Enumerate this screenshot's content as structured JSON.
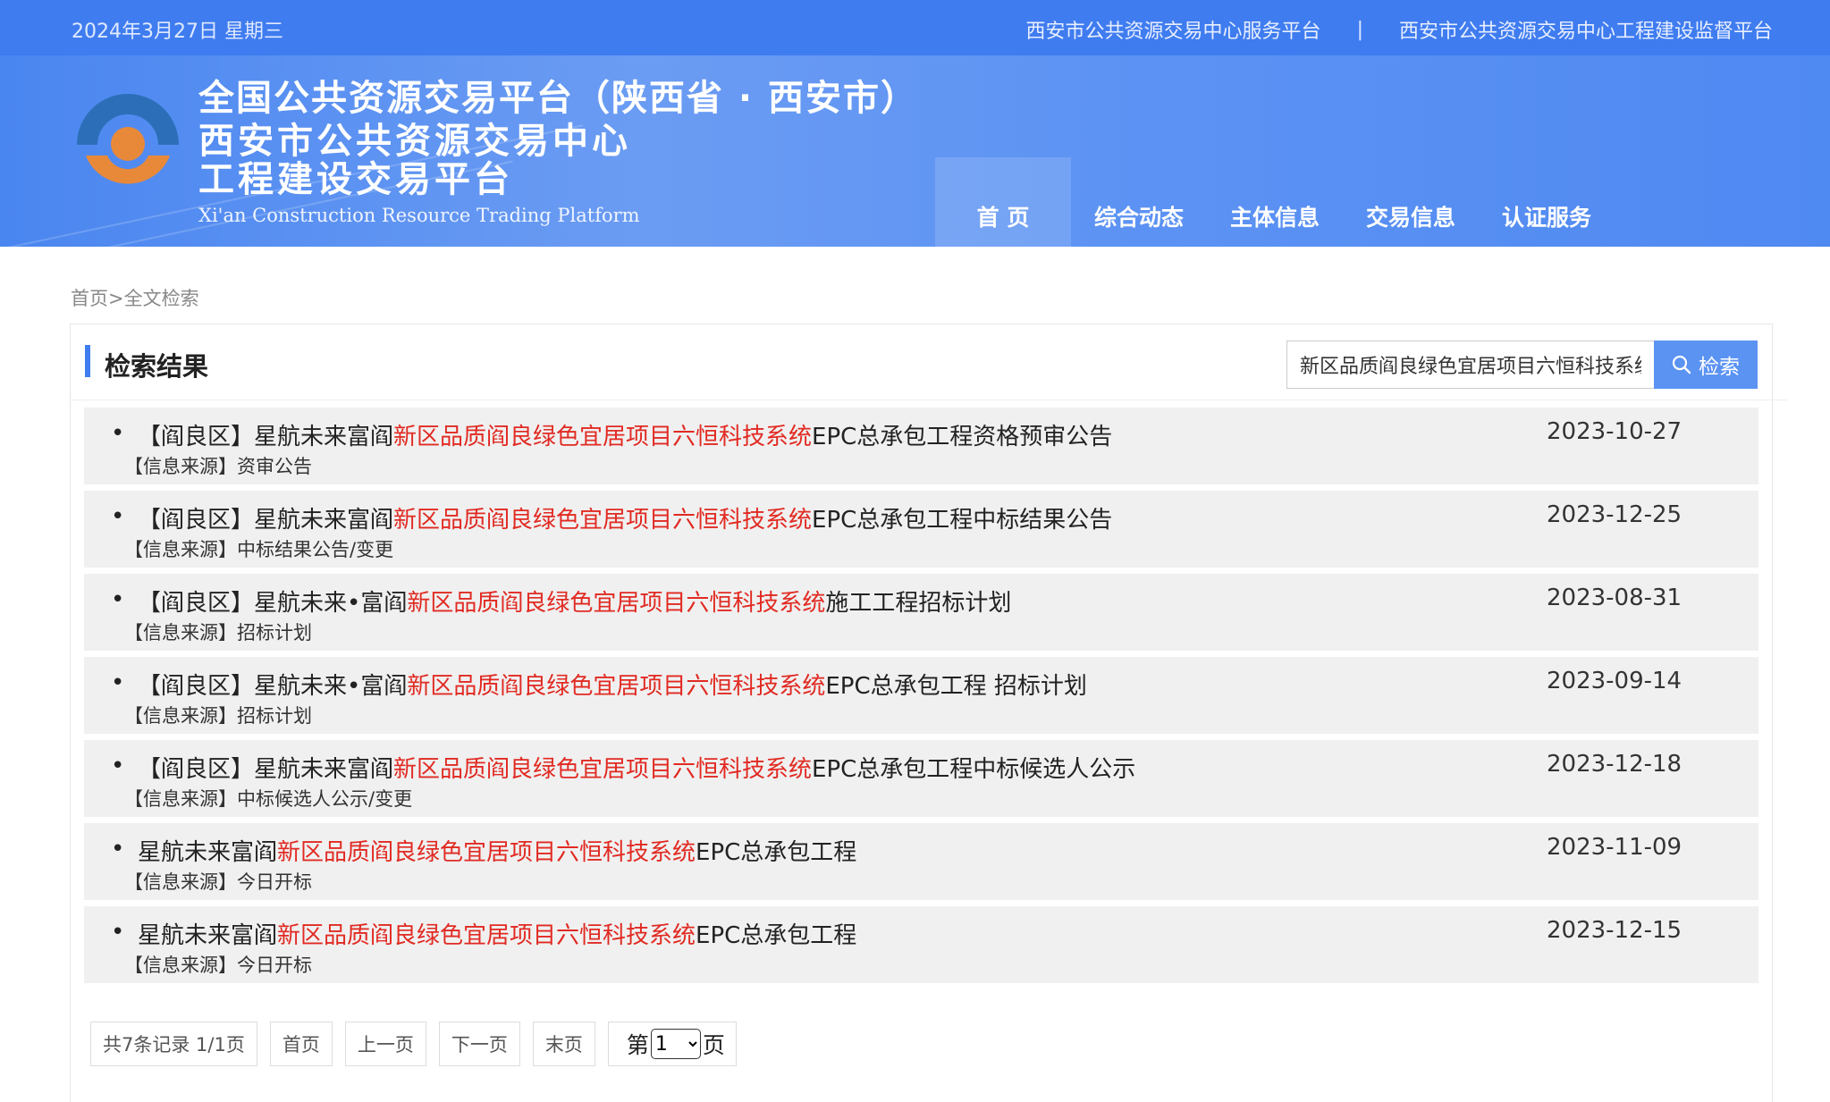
{
  "topbar": {
    "date": "2024年3月27日 星期三",
    "link1": "西安市公共资源交易中心服务平台",
    "separator": "|",
    "link2": "西安市公共资源交易中心工程建设监督平台"
  },
  "header": {
    "title_line1": "全国公共资源交易平台（陕西省 · 西安市）",
    "title_line2": "西安市公共资源交易中心",
    "title_line3": "工程建设交易平台",
    "title_en": "Xi'an Construction Resource Trading Platform",
    "nav": [
      "首 页",
      "综合动态",
      "主体信息",
      "交易信息",
      "认证服务"
    ],
    "colors": {
      "bar": "#3f7cf0",
      "logo_blue": "#2c6fb8",
      "logo_orange": "#e8893a"
    }
  },
  "breadcrumb": {
    "home": "首页",
    "sep": ">",
    "current": "全文检索"
  },
  "panel": {
    "title": "检索结果",
    "search_value": "新区品质阎良绿色宜居项目六恒科技系统",
    "search_button": "检索"
  },
  "results": [
    {
      "prefix": "【阎良区】星航未来富阎",
      "highlight": "新区品质阎良绿色宜居项目六恒科技系统",
      "suffix": "EPC总承包工程资格预审公告",
      "source": "【信息来源】资审公告",
      "date": "2023-10-27"
    },
    {
      "prefix": "【阎良区】星航未来富阎",
      "highlight": "新区品质阎良绿色宜居项目六恒科技系统",
      "suffix": "EPC总承包工程中标结果公告",
      "source": "【信息来源】中标结果公告/变更",
      "date": "2023-12-25"
    },
    {
      "prefix": "【阎良区】星航未来•富阎",
      "highlight": "新区品质阎良绿色宜居项目六恒科技系统",
      "suffix": "施工工程招标计划",
      "source": "【信息来源】招标计划",
      "date": "2023-08-31"
    },
    {
      "prefix": "【阎良区】星航未来•富阎",
      "highlight": "新区品质阎良绿色宜居项目六恒科技系统",
      "suffix": "EPC总承包工程 招标计划",
      "source": "【信息来源】招标计划",
      "date": "2023-09-14"
    },
    {
      "prefix": "【阎良区】星航未来富阎",
      "highlight": "新区品质阎良绿色宜居项目六恒科技系统",
      "suffix": "EPC总承包工程中标候选人公示",
      "source": "【信息来源】中标候选人公示/变更",
      "date": "2023-12-18"
    },
    {
      "prefix": "星航未来富阎",
      "highlight": "新区品质阎良绿色宜居项目六恒科技系统",
      "suffix": "EPC总承包工程",
      "source": "【信息来源】今日开标",
      "date": "2023-11-09"
    },
    {
      "prefix": "星航未来富阎",
      "highlight": "新区品质阎良绿色宜居项目六恒科技系统",
      "suffix": "EPC总承包工程",
      "source": "【信息来源】今日开标",
      "date": "2023-12-15"
    }
  ],
  "pager": {
    "info": "共7条记录 1/1页",
    "first": "首页",
    "prev": "上一页",
    "next": "下一页",
    "last": "末页",
    "jump_prefix": "第",
    "jump_value": "1",
    "jump_suffix": "页"
  }
}
